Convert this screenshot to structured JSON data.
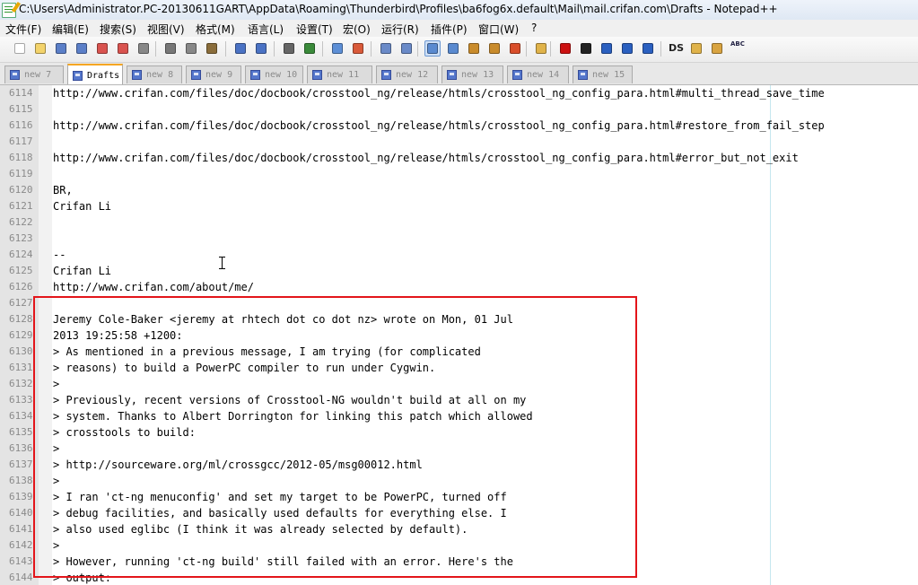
{
  "window": {
    "title": "C:\\Users\\Administrator.PC-20130611GART\\AppData\\Roaming\\Thunderbird\\Profiles\\ba6fog6x.default\\Mail\\mail.crifan.com\\Drafts - Notepad++"
  },
  "menu": [
    "文件(F)",
    "编辑(E)",
    "搜索(S)",
    "视图(V)",
    "格式(M)",
    "语言(L)",
    "设置(T)",
    "宏(O)",
    "运行(R)",
    "插件(P)",
    "窗口(W)",
    "?"
  ],
  "toolbar": {
    "buttons": [
      "new-file-icon",
      "open-file-icon",
      "save-icon",
      "save-all-icon",
      "close-icon",
      "close-all-icon",
      "print-icon",
      "cut-icon",
      "copy-icon",
      "paste-icon",
      "undo-icon",
      "redo-icon",
      "find-icon",
      "replace-icon",
      "zoom-in-icon",
      "zoom-out-icon",
      "sync-vertical-icon",
      "sync-horizontal-icon",
      "word-wrap-icon",
      "show-all-chars-icon",
      "indent-guide-icon",
      "document-map-icon",
      "function-list-icon",
      "folder-workspace-icon",
      "record-macro-icon",
      "stop-record-icon",
      "play-macro-icon",
      "run-macro-multiple-icon",
      "save-macro-icon",
      "ds-plugin-icon",
      "explorer-plugin-icon",
      "plugin-icon",
      "spell-check-icon"
    ]
  },
  "tabs": [
    "new  7",
    "Drafts",
    "new  8",
    "new  9",
    "new  10",
    "new  11",
    "new  12",
    "new  13",
    "new  14",
    "new  15"
  ],
  "active_tab": 1,
  "lines": [
    {
      "n": "6114",
      "t": "http://www.crifan.com/files/doc/docbook/crosstool_ng/release/htmls/crosstool_ng_config_para.html#multi_thread_save_time"
    },
    {
      "n": "6115",
      "t": ""
    },
    {
      "n": "6116",
      "t": "http://www.crifan.com/files/doc/docbook/crosstool_ng/release/htmls/crosstool_ng_config_para.html#restore_from_fail_step"
    },
    {
      "n": "6117",
      "t": ""
    },
    {
      "n": "6118",
      "t": "http://www.crifan.com/files/doc/docbook/crosstool_ng/release/htmls/crosstool_ng_config_para.html#error_but_not_exit"
    },
    {
      "n": "6119",
      "t": ""
    },
    {
      "n": "6120",
      "t": "BR,"
    },
    {
      "n": "6121",
      "t": "Crifan Li"
    },
    {
      "n": "6122",
      "t": ""
    },
    {
      "n": "6123",
      "t": ""
    },
    {
      "n": "6124",
      "t": "--"
    },
    {
      "n": "6125",
      "t": "Crifan Li"
    },
    {
      "n": "6126",
      "t": "http://www.crifan.com/about/me/"
    },
    {
      "n": "6127",
      "t": ""
    },
    {
      "n": "6128",
      "t": "Jeremy Cole-Baker <jeremy at rhtech dot co dot nz> wrote on Mon, 01 Jul"
    },
    {
      "n": "6129",
      "t": "2013 19:25:58 +1200:"
    },
    {
      "n": "6130",
      "t": "> As mentioned in a previous message, I am trying (for complicated"
    },
    {
      "n": "6131",
      "t": "> reasons) to build a PowerPC compiler to run under Cygwin."
    },
    {
      "n": "6132",
      "t": ">"
    },
    {
      "n": "6133",
      "t": "> Previously, recent versions of Crosstool-NG wouldn't build at all on my"
    },
    {
      "n": "6134",
      "t": "> system. Thanks to Albert Dorrington for linking this patch which allowed"
    },
    {
      "n": "6135",
      "t": "> crosstools to build:"
    },
    {
      "n": "6136",
      "t": ">"
    },
    {
      "n": "6137",
      "t": "> http://sourceware.org/ml/crossgcc/2012-05/msg00012.html"
    },
    {
      "n": "6138",
      "t": ">"
    },
    {
      "n": "6139",
      "t": "> I ran 'ct-ng menuconfig' and set my target to be PowerPC, turned off"
    },
    {
      "n": "6140",
      "t": "> debug facilities, and basically used defaults for everything else. I"
    },
    {
      "n": "6141",
      "t": "> also used eglibc (I think it was already selected by default)."
    },
    {
      "n": "6142",
      "t": ">"
    },
    {
      "n": "6143",
      "t": "> However, running 'ct-ng build' still failed with an error. Here's the"
    },
    {
      "n": "6144",
      "t": "> output:"
    }
  ],
  "colors": {
    "highlight_border": "#e3151a",
    "gutter_bg": "#e4e4e4",
    "active_tab_accent": "#f5a623"
  }
}
